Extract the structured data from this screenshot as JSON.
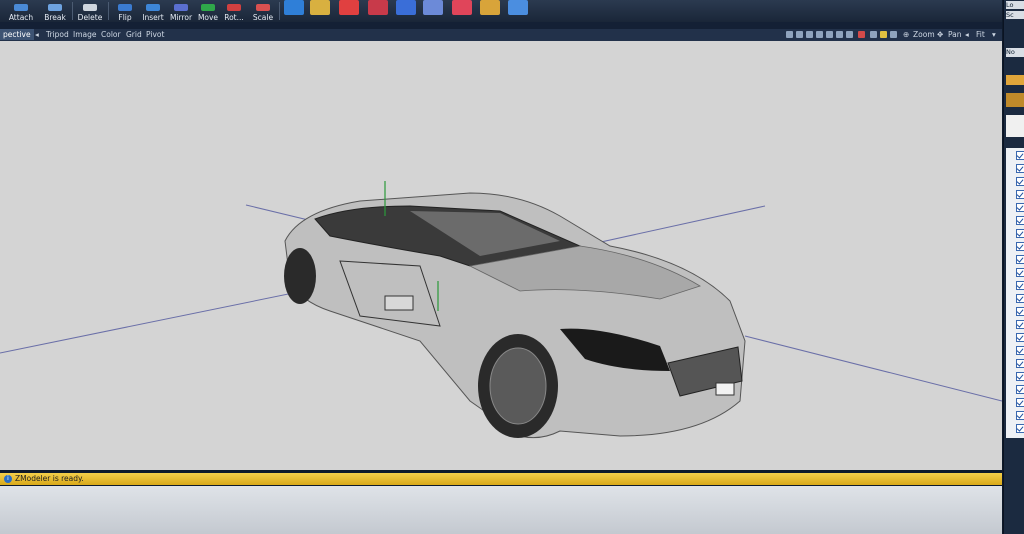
{
  "toolbar": {
    "buttons": [
      {
        "label": "Attach"
      },
      {
        "label": "Break"
      },
      {
        "label": "Delete"
      },
      {
        "label": "Flip"
      },
      {
        "label": "Insert"
      },
      {
        "label": "Mirror"
      },
      {
        "label": "Move"
      },
      {
        "label": "Rot..."
      },
      {
        "label": "Scale"
      }
    ]
  },
  "viewport": {
    "title": "pective",
    "menu": [
      "Tripod",
      "Image",
      "Color",
      "Grid",
      "Pivot"
    ],
    "nav": {
      "zoom": "Zoom",
      "pan": "Pan",
      "fit": "Fit"
    }
  },
  "right_panel": {
    "top_labels": [
      "Lo",
      "Sc",
      "No"
    ]
  },
  "status": {
    "message": "ZModeler is ready."
  },
  "colors": {
    "accent": "#3d5373",
    "status_bar": "#f0c33c",
    "viewport_bg": "#d4d4d4"
  }
}
